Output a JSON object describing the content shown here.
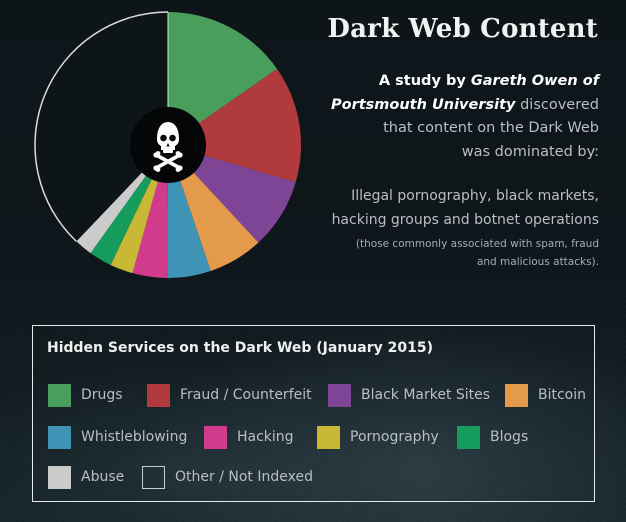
{
  "title": "Dark Web Content",
  "description": {
    "lines": [
      [
        {
          "text": "A study by ",
          "style": "strong"
        },
        {
          "text": "Gareth Owen of",
          "style": "strong-em"
        }
      ],
      [
        {
          "text": "Portsmouth University",
          "style": "strong-em"
        },
        {
          "text": " discovered",
          "style": "light"
        }
      ],
      [
        {
          "text": "that content on the Dark Web",
          "style": "light"
        }
      ],
      [
        {
          "text": "was dominated by:",
          "style": "light"
        }
      ]
    ]
  },
  "summary": {
    "line1": "Illegal pornography, black markets,",
    "line2": "hacking groups and botnet operations",
    "note_line1": "(those commonly associated with spam, fraud",
    "note_line2": "and malicious attacks)."
  },
  "center_icon": "skull-crossbones-icon",
  "legend": {
    "title": "Hidden Services on the Dark Web (January 2015)"
  },
  "chart_data": {
    "type": "pie",
    "title": "Hidden Services on the Dark Web (January 2015)",
    "start_angle_deg": 0,
    "direction": "clockwise",
    "unit": "percent (estimated from slice angles)",
    "legend_position": "bottom",
    "slices": [
      {
        "label": "Drugs",
        "value": 15.3,
        "color": "#4a9e5c"
      },
      {
        "label": "Fraud / Counterfeit",
        "value": 14.2,
        "color": "#b13a3c"
      },
      {
        "label": "Black Market Sites",
        "value": 8.6,
        "color": "#7e4597"
      },
      {
        "label": "Bitcoin",
        "value": 6.7,
        "color": "#e39a4a"
      },
      {
        "label": "Whistleblowing",
        "value": 5.3,
        "color": "#3f93b5"
      },
      {
        "label": "Hacking",
        "value": 4.2,
        "color": "#d23a8b"
      },
      {
        "label": "Pornography",
        "value": 2.8,
        "color": "#c9b836"
      },
      {
        "label": "Blogs",
        "value": 2.8,
        "color": "#169c5d"
      },
      {
        "label": "Abuse",
        "value": 2.2,
        "color": "#cbcbcb"
      },
      {
        "label": "Other / Not Indexed",
        "value": 37.9,
        "color": "#0d1519",
        "outline": "#d9dcdc"
      }
    ]
  }
}
